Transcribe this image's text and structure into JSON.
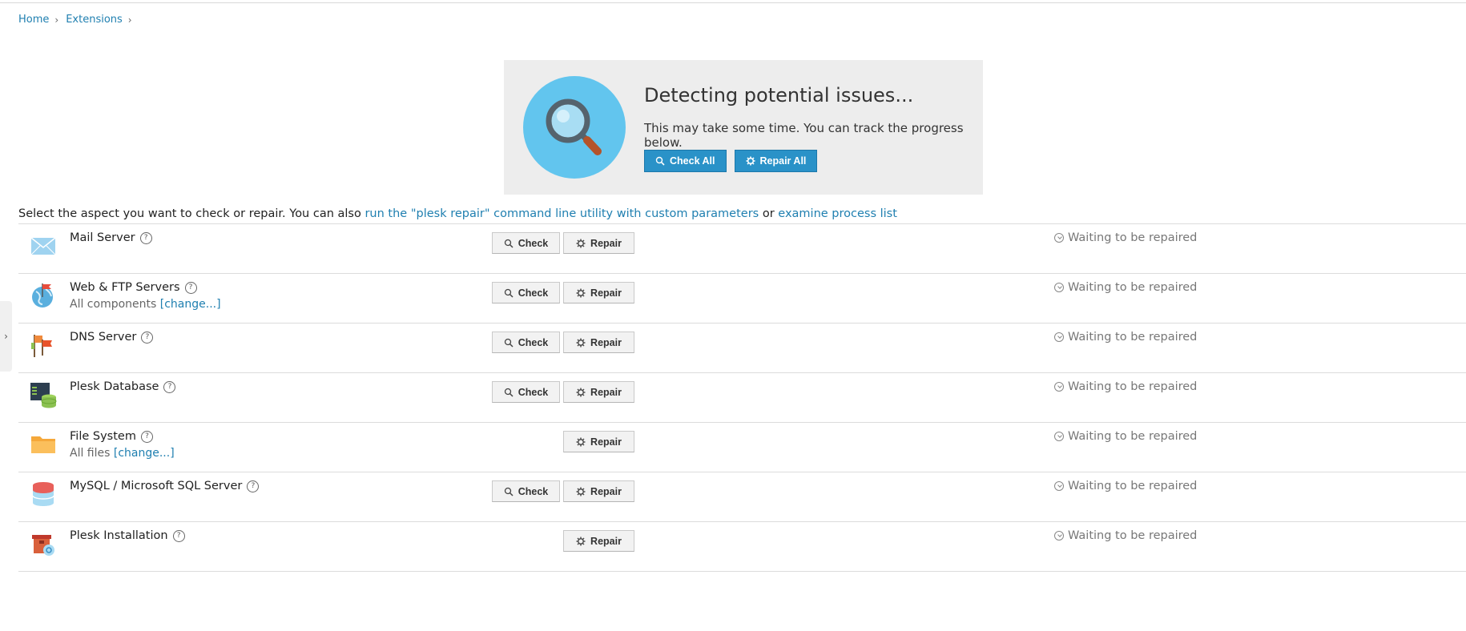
{
  "breadcrumb": {
    "items": [
      "Home",
      "Extensions"
    ]
  },
  "hero": {
    "title": "Detecting potential issues...",
    "subtitle": "This may take some time. You can track the progress below.",
    "check_all_label": "Check All",
    "repair_all_label": "Repair All",
    "icon": "magnifier-icon"
  },
  "instruction": {
    "prefix": "Select the aspect you want to check or repair. You can also ",
    "link1": "run the \"plesk repair\" command line utility with custom parameters",
    "middle": " or ",
    "link2": "examine process list"
  },
  "labels": {
    "check": "Check",
    "repair": "Repair",
    "help": "?"
  },
  "rows": [
    {
      "name": "Mail Server",
      "icon": "mail-envelope-icon",
      "has_check": true,
      "status": "Waiting to be repaired"
    },
    {
      "name": "Web & FTP Servers",
      "icon": "globe-flag-icon",
      "has_check": true,
      "sub_text": "All components ",
      "sub_link": "[change...]",
      "status": "Waiting to be repaired"
    },
    {
      "name": "DNS Server",
      "icon": "dns-flags-icon",
      "has_check": true,
      "status": "Waiting to be repaired"
    },
    {
      "name": "Plesk Database",
      "icon": "database-window-icon",
      "has_check": true,
      "status": "Waiting to be repaired"
    },
    {
      "name": "File System",
      "icon": "folder-icon",
      "has_check": false,
      "sub_text": "All files ",
      "sub_link": "[change...]",
      "status": "Waiting to be repaired"
    },
    {
      "name": "MySQL / Microsoft SQL Server",
      "icon": "database-stack-icon",
      "has_check": true,
      "status": "Waiting to be repaired"
    },
    {
      "name": "Plesk Installation",
      "icon": "package-box-icon",
      "has_check": false,
      "status": "Waiting to be repaired"
    }
  ],
  "colors": {
    "accent": "#2a92c8",
    "link": "#1f7fb0",
    "hero_bg": "#ededed",
    "hero_circle": "#62c5ee"
  }
}
